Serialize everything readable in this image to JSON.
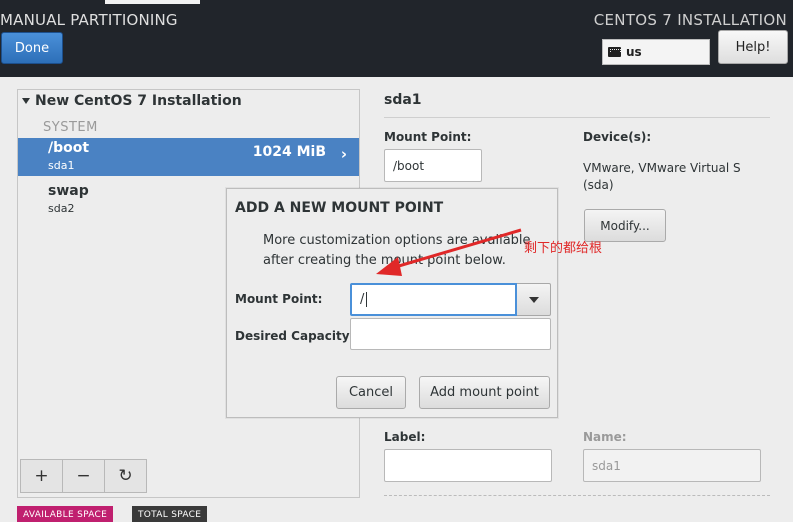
{
  "header": {
    "title": "MANUAL PARTITIONING",
    "product": "CENTOS 7 INSTALLATION",
    "done_label": "Done",
    "keyboard_layout": "us",
    "help_label": "Help!"
  },
  "left_panel": {
    "install_title": "New CentOS 7 Installation",
    "section_label": "SYSTEM",
    "mounts": [
      {
        "mount_point": "/boot",
        "device": "sda1",
        "size": "1024 MiB",
        "selected": true
      },
      {
        "mount_point": "swap",
        "device": "sda2",
        "size": "",
        "selected": false
      }
    ],
    "toolbar": {
      "add_glyph": "+",
      "remove_glyph": "−",
      "refresh_glyph": "↻"
    },
    "available_space_label": "AVAILABLE SPACE",
    "total_space_label": "TOTAL SPACE",
    "colors": {
      "selected_row": "#4a82c3",
      "available_badge": "#c0206f",
      "total_badge": "#3a3a3a"
    }
  },
  "right_panel": {
    "title": "sda1",
    "mount_point_label": "Mount Point:",
    "mount_point_value": "/boot",
    "devices_label": "Device(s):",
    "devices_text": "VMware, VMware Virtual S (sda)",
    "modify_label": "Modify...",
    "label_label": "Label:",
    "label_value": "",
    "name_label": "Name:",
    "name_value": "sda1"
  },
  "dialog": {
    "title": "ADD A NEW MOUNT POINT",
    "info": "More customization options are available after creating the mount point below.",
    "mount_point_label": "Mount Point:",
    "mount_point_value": "/",
    "capacity_label": "Desired Capacity:",
    "capacity_value": "",
    "cancel_label": "Cancel",
    "add_label": "Add mount point"
  },
  "annotation": {
    "text": "剩下的都给根",
    "color": "#e02828"
  }
}
